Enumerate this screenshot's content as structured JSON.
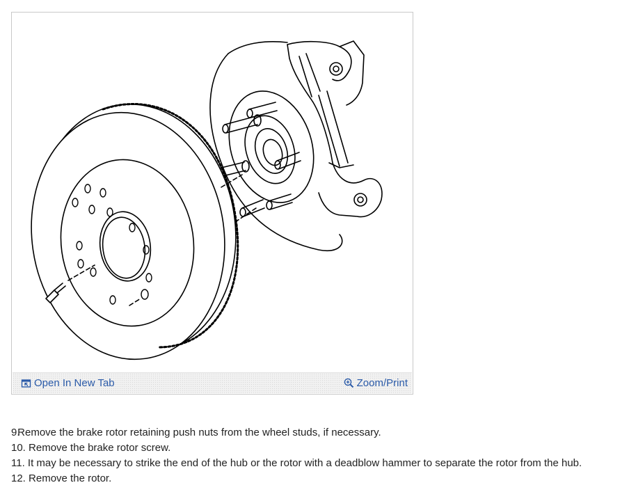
{
  "figure": {
    "open_tab_label": "Open In New Tab",
    "zoom_label": "Zoom/Print",
    "open_tab_icon": "open-new-tab-icon",
    "zoom_icon": "magnifier-plus-icon",
    "link_color": "#2a5aa8"
  },
  "steps": [
    {
      "number": "9.",
      "text": "Remove the brake rotor retaining push nuts from the wheel studs, if necessary."
    },
    {
      "number": "10.",
      "text": "Remove the brake rotor screw."
    },
    {
      "number": "11.",
      "text": "It may be necessary to strike the end of the hub or the rotor with a deadblow hammer to separate the rotor from the hub."
    },
    {
      "number": "12.",
      "text": "Remove the rotor."
    }
  ]
}
